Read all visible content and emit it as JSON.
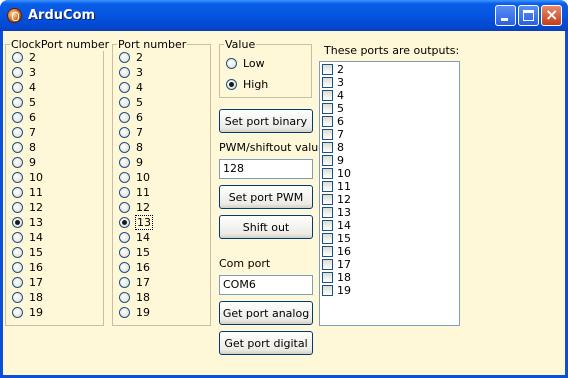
{
  "window": {
    "title": "ArduCom"
  },
  "clock_group": {
    "label": "ClockPort number",
    "options": [
      "2",
      "3",
      "4",
      "5",
      "6",
      "7",
      "8",
      "9",
      "10",
      "11",
      "12",
      "13",
      "14",
      "15",
      "16",
      "17",
      "18",
      "19"
    ],
    "selected": "13"
  },
  "port_group": {
    "label": "Port number",
    "options": [
      "2",
      "3",
      "4",
      "5",
      "6",
      "7",
      "8",
      "9",
      "10",
      "11",
      "12",
      "13",
      "14",
      "15",
      "16",
      "17",
      "18",
      "19"
    ],
    "selected": "13"
  },
  "value_group": {
    "label": "Value",
    "low_label": "Low",
    "high_label": "High",
    "selected": "High"
  },
  "buttons": {
    "set_binary": "Set port binary",
    "set_pwm": "Set port PWM",
    "shift_out": "Shift out",
    "get_analog": "Get port analog",
    "get_digital": "Get port digital"
  },
  "pwm": {
    "label": "PWM/shiftout value",
    "value": "128"
  },
  "com": {
    "label": "Com port",
    "value": "COM6"
  },
  "outputs": {
    "label": "These ports are outputs:",
    "items": [
      "2",
      "3",
      "4",
      "5",
      "6",
      "7",
      "8",
      "9",
      "10",
      "11",
      "12",
      "13",
      "14",
      "15",
      "16",
      "17",
      "18",
      "19"
    ]
  }
}
